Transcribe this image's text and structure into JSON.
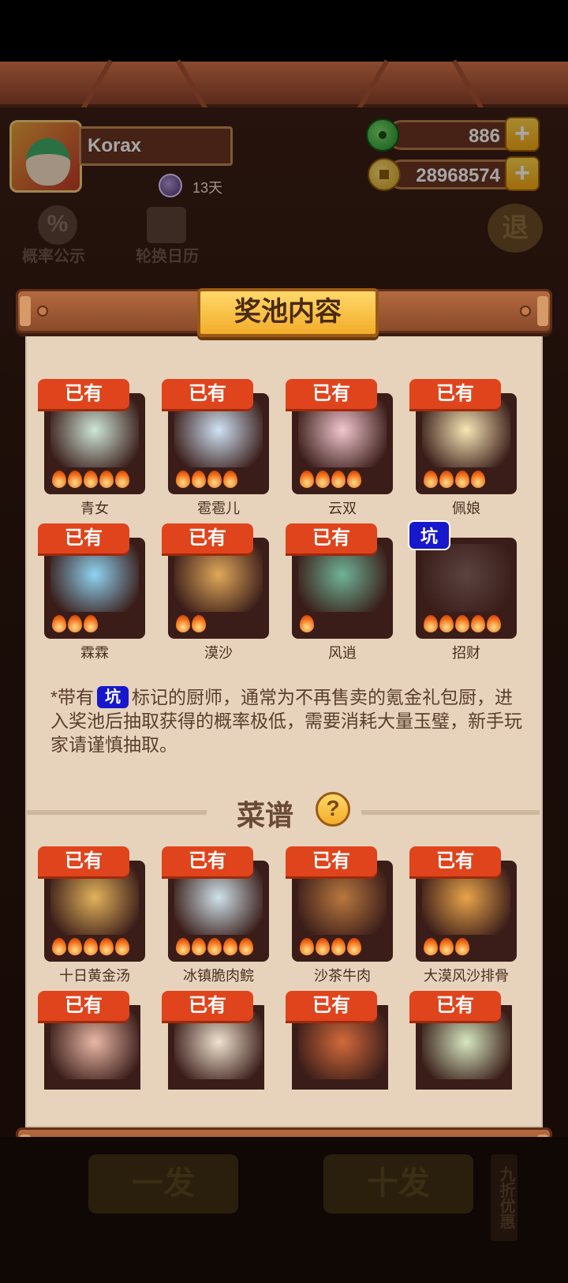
{
  "player": {
    "name": "Korax",
    "days": "13天"
  },
  "currencies": {
    "jade": "886",
    "coins": "28968574"
  },
  "top_buttons": {
    "rate": "概率公示",
    "calendar": "轮换日历",
    "exit": "退"
  },
  "panel": {
    "title": "奖池内容",
    "owned_label": "已有",
    "pit_label": "坑",
    "chefs": [
      {
        "name": "青女",
        "status": "owned",
        "stars": 5,
        "art_color": "#cfe6d8"
      },
      {
        "name": "雹雹儿",
        "status": "owned",
        "stars": 4,
        "art_color": "#cfe3f6"
      },
      {
        "name": "云双",
        "status": "owned",
        "stars": 4,
        "art_color": "#f2c7cf"
      },
      {
        "name": "佩娘",
        "status": "owned",
        "stars": 4,
        "art_color": "#f7e6b6"
      },
      {
        "name": "霖霖",
        "status": "owned",
        "stars": 3,
        "art_color": "#8fd4f2"
      },
      {
        "name": "漠沙",
        "status": "owned",
        "stars": 2,
        "art_color": "#e0a85a"
      },
      {
        "name": "风逍",
        "status": "owned",
        "stars": 1,
        "art_color": "#6fb497"
      },
      {
        "name": "招财",
        "status": "pit",
        "stars": 5,
        "art_color": "#5b4340"
      }
    ],
    "note_prefix": "*带有",
    "note_suffix": "标记的厨师，通常为不再售卖的氪金礼包厨，进入奖池后抽取获得的概率极低，需要消耗大量玉璧，新手玩家请谨慎抽取。",
    "recipes_title": "菜谱",
    "help_symbol": "?",
    "recipes": [
      {
        "name": "十日黄金汤",
        "status": "owned",
        "stars": 5,
        "art_color": "#e3b35b"
      },
      {
        "name": "冰镇脆肉鲩",
        "status": "owned",
        "stars": 5,
        "art_color": "#cfe2ea"
      },
      {
        "name": "沙茶牛肉",
        "status": "owned",
        "stars": 4,
        "art_color": "#b9783f"
      },
      {
        "name": "大漠风沙排骨",
        "status": "owned",
        "stars": 3,
        "art_color": "#e8a44a"
      },
      {
        "name": "",
        "status": "owned",
        "stars": 0,
        "art_color": "#e9b7a6"
      },
      {
        "name": "",
        "status": "owned",
        "stars": 0,
        "art_color": "#efe2cf"
      },
      {
        "name": "",
        "status": "owned",
        "stars": 0,
        "art_color": "#d26a3b"
      },
      {
        "name": "",
        "status": "owned",
        "stars": 0,
        "art_color": "#d6e7c0"
      }
    ]
  },
  "bottom": {
    "single": "一发",
    "ten": "十发",
    "discount": "九折优惠"
  }
}
